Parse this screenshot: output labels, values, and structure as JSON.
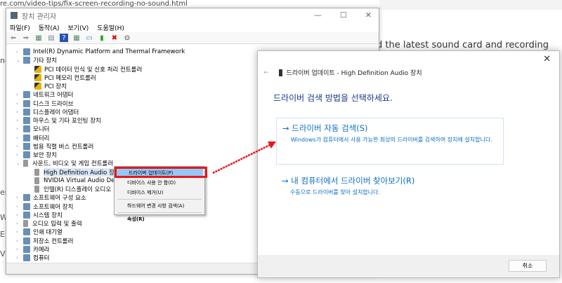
{
  "background": {
    "url": "re.com/video-tips/fix-screen-recording-no-sound.html",
    "article_text": "d the latest sound card and recording",
    "side_letters": [
      "nd",
      "er",
      "W",
      "Er",
      "VI"
    ]
  },
  "device_manager": {
    "title": "장치 관리자",
    "window_buttons": [
      "—",
      "☐",
      "✕"
    ],
    "menu": [
      "파일(F)",
      "동작(A)",
      "보기(V)",
      "도움말(H)"
    ],
    "tree": [
      {
        "label": "Intel(R) Dynamic Platform and Thermal Framework",
        "level": 0,
        "expanded": false,
        "icon": "device"
      },
      {
        "label": "기타 장치",
        "level": 0,
        "expanded": true,
        "icon": "device"
      },
      {
        "label": "PCI 데이터 인식 및 신호 처리 컨트롤러",
        "level": 1,
        "icon": "warning"
      },
      {
        "label": "PCI 메모리 컨트롤러",
        "level": 1,
        "icon": "warning"
      },
      {
        "label": "PCI 장치",
        "level": 1,
        "icon": "warning"
      },
      {
        "label": "네트워크 어댑터",
        "level": 0,
        "expanded": false,
        "icon": "device"
      },
      {
        "label": "디스크 드라이브",
        "level": 0,
        "expanded": false,
        "icon": "device"
      },
      {
        "label": "디스플레이 어댑터",
        "level": 0,
        "expanded": false,
        "icon": "device"
      },
      {
        "label": "마우스 및 기타 포인팅 장치",
        "level": 0,
        "expanded": false,
        "icon": "device"
      },
      {
        "label": "모니터",
        "level": 0,
        "expanded": false,
        "icon": "device"
      },
      {
        "label": "배터리",
        "level": 0,
        "expanded": false,
        "icon": "device"
      },
      {
        "label": "범용 직렬 버스 컨트롤러",
        "level": 0,
        "expanded": false,
        "icon": "device"
      },
      {
        "label": "보안 장치",
        "level": 0,
        "expanded": false,
        "icon": "device"
      },
      {
        "label": "사운드, 비디오 및 게임 컨트롤러",
        "level": 0,
        "expanded": true,
        "icon": "speaker"
      },
      {
        "label": "High Definition Audio 장치",
        "level": 1,
        "icon": "speaker",
        "selected": true
      },
      {
        "label": "NVIDIA Virtual Audio Device",
        "level": 1,
        "icon": "speaker"
      },
      {
        "label": "인텔(R) 디스플레이 오디오",
        "level": 1,
        "icon": "speaker"
      },
      {
        "label": "소프트웨어 구성 요소",
        "level": 0,
        "expanded": false,
        "icon": "device"
      },
      {
        "label": "소프트웨어 장치",
        "level": 0,
        "expanded": false,
        "icon": "device"
      },
      {
        "label": "시스템 장치",
        "level": 0,
        "expanded": false,
        "icon": "device"
      },
      {
        "label": "오디오 입력 및 출력",
        "level": 0,
        "expanded": false,
        "icon": "speaker"
      },
      {
        "label": "인쇄 대기열",
        "level": 0,
        "expanded": false,
        "icon": "device"
      },
      {
        "label": "저장소 컨트롤러",
        "level": 0,
        "expanded": false,
        "icon": "device"
      },
      {
        "label": "카메라",
        "level": 0,
        "expanded": false,
        "icon": "device"
      },
      {
        "label": "컴퓨터",
        "level": 0,
        "expanded": false,
        "icon": "device"
      },
      {
        "label": "키보드",
        "level": 0,
        "expanded": false,
        "icon": "device"
      }
    ]
  },
  "context_menu": {
    "items": [
      "드라이버 업데이트(P)",
      "디바이스 사용 안 함(D)",
      "디바이스 제거(U)",
      "하드웨어 변경 사항 검색(A)",
      "속성(R)"
    ]
  },
  "dialog": {
    "header": "드라이버 업데이트 - High Definition Audio 장치",
    "heading": "드라이버 검색 방법을 선택하세요.",
    "option1": {
      "title": "→  드라이버 자동 검색(S)",
      "desc": "Windows가 컴퓨터에서 사용 가능한 최상의 드라이버를 검색하여 장치에 설치합니다."
    },
    "option2": {
      "title": "→  내 컴퓨터에서 드라이버 찾아보기(R)",
      "desc": "수동으로 드라이버를 찾아 설치합니다."
    },
    "cancel": "취소",
    "close": "✕"
  },
  "colors": {
    "highlight": "#e8161d",
    "link": "#0b6ec4",
    "heading": "#1a3b8c"
  }
}
